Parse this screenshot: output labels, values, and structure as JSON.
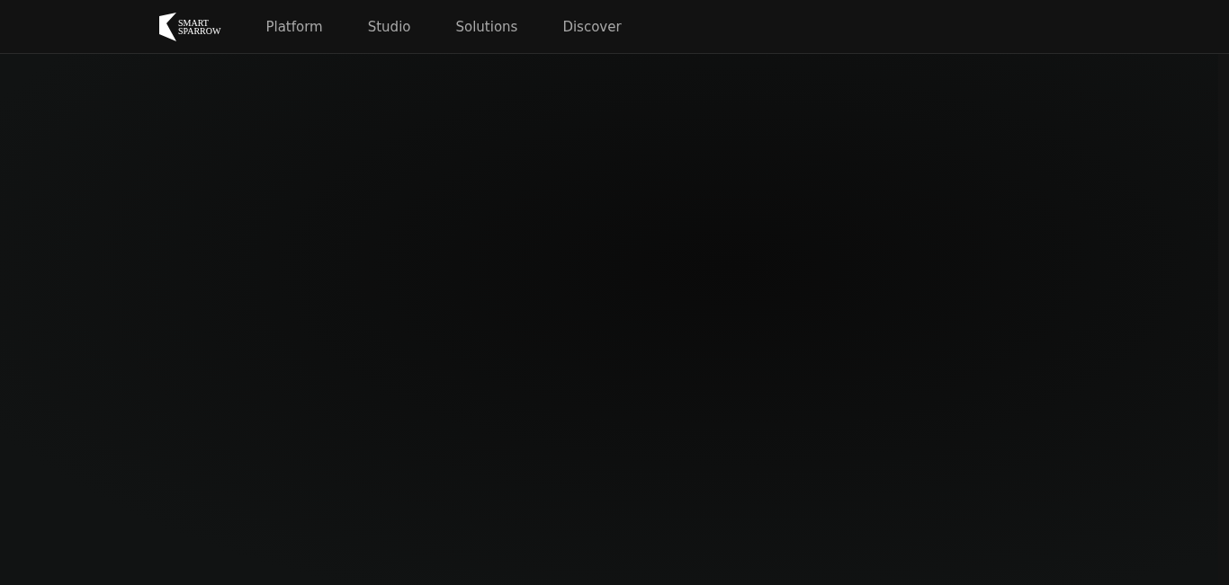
{
  "logo": {
    "line_1": "SMART",
    "line_2": "SPARROW"
  },
  "nav": [
    {
      "label": "Platform"
    },
    {
      "label": "Studio"
    },
    {
      "label": "Solutions"
    },
    {
      "label": "Discover"
    }
  ]
}
